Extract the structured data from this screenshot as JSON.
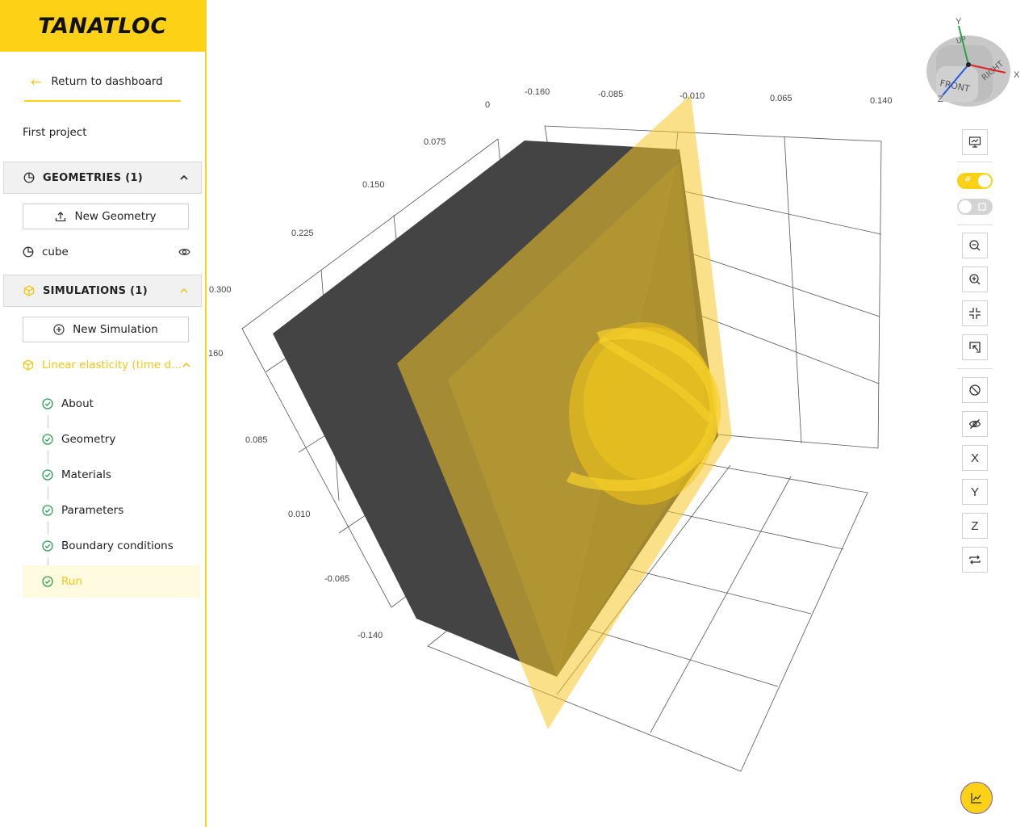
{
  "brand": {
    "logo": "TANATLOC",
    "accent": "#fcd116"
  },
  "sidebar": {
    "return_label": "Return to dashboard",
    "project_name": "First project",
    "geometries": {
      "title": "GEOMETRIES (1)",
      "new_button": "New Geometry",
      "items": [
        {
          "label": "cube"
        }
      ]
    },
    "simulations": {
      "title": "SIMULATIONS (1)",
      "new_button": "New Simulation",
      "items": [
        {
          "label": "Linear elasticity (time d..."
        }
      ],
      "steps": [
        {
          "label": "About",
          "done": true
        },
        {
          "label": "Geometry",
          "done": true
        },
        {
          "label": "Materials",
          "done": true
        },
        {
          "label": "Parameters",
          "done": true
        },
        {
          "label": "Boundary conditions",
          "done": true
        },
        {
          "label": "Run",
          "done": true,
          "active": true
        }
      ]
    }
  },
  "viewport": {
    "axis_ticks_top": [
      "0",
      "-0.160",
      "-0.085",
      "-0.010",
      "0.065",
      "0.140"
    ],
    "axis_ticks_left": [
      "0.075",
      "0.150",
      "0.225",
      "0.300",
      "160"
    ],
    "axis_ticks_lower": [
      "0.085",
      "0.010",
      "-0.065",
      "-0.140"
    ],
    "view_cube": {
      "up": "UP",
      "front": "FRONT",
      "right": "RIGHT",
      "x": "X",
      "y": "Y",
      "z": "Z"
    }
  },
  "toolbar": {
    "screenshot_icon": "presentation-icon",
    "grid_toggle_on": true,
    "grid_glyph": "#",
    "second_toggle_on": false,
    "x_label": "X",
    "y_label": "Y",
    "z_label": "Z"
  }
}
